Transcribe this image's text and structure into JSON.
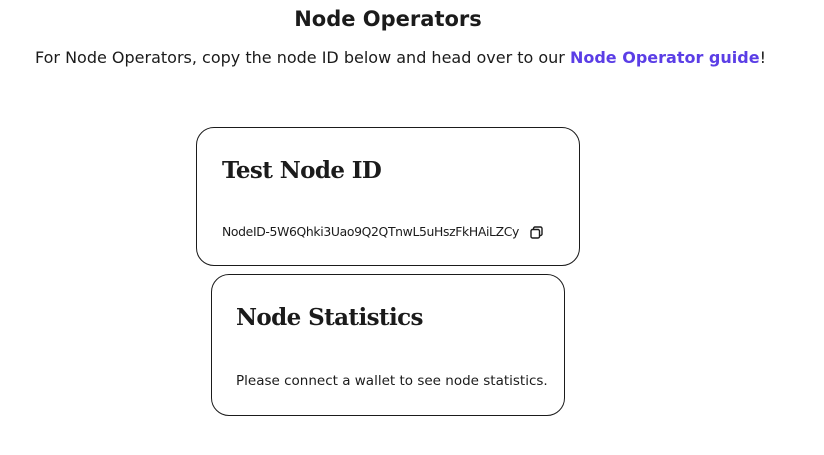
{
  "header": {
    "title": "Node Operators",
    "intro_text": "For Node Operators, copy the node ID below and head over to our ",
    "guide_link_label": "Node Operator guide",
    "intro_suffix": "!",
    "link_color": "#5b3ee6"
  },
  "node_id_card": {
    "heading": "Test Node ID",
    "node_id": "NodeID-5W6Qhki3Uao9Q2QTnwL5uHszFkHAiLZCy",
    "copy_icon": "copy-icon"
  },
  "stats_card": {
    "heading": "Node Statistics",
    "message": "Please connect a wallet to see node statistics."
  }
}
